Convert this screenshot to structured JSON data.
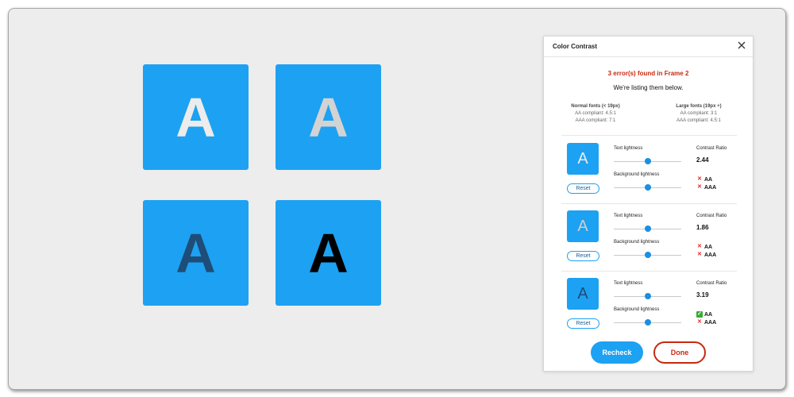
{
  "tiles": [
    {
      "letter": "A",
      "color": "#ececec"
    },
    {
      "letter": "A",
      "color": "#d3d3d3"
    },
    {
      "letter": "A",
      "color": "#1e4d78"
    },
    {
      "letter": "A",
      "color": "#000000"
    }
  ],
  "tile_background": "#1da1f2",
  "panel": {
    "title": "Color Contrast",
    "error_message": "3 error(s) found in Frame 2",
    "sub_message": "We're listing them below.",
    "normal_fonts": {
      "heading": "Normal fonts (< 19px)",
      "aa": "AA compliant: 4.5:1",
      "aaa": "AAA compliant: 7:1"
    },
    "large_fonts": {
      "heading": "Large fonts (19px +)",
      "aa": "AA compliant: 3:1",
      "aaa": "AAA compliant: 4.5:1"
    },
    "text_lightness_label": "Text lightness",
    "background_lightness_label": "Background lightness",
    "contrast_ratio_label": "Contrast Ratio",
    "reset_label": "Reset",
    "errors": [
      {
        "letter": "A",
        "letter_color": "#ececec",
        "ratio": "2.44",
        "text_lightness": 0.5,
        "background_lightness": 0.5,
        "aa": "AA",
        "aa_pass": false,
        "aaa": "AAA",
        "aaa_pass": false
      },
      {
        "letter": "A",
        "letter_color": "#cfcfcf",
        "ratio": "1.86",
        "text_lightness": 0.5,
        "background_lightness": 0.5,
        "aa": "AA",
        "aa_pass": false,
        "aaa": "AAA",
        "aaa_pass": false
      },
      {
        "letter": "A",
        "letter_color": "#1e4d78",
        "ratio": "3.19",
        "text_lightness": 0.5,
        "background_lightness": 0.5,
        "aa": "AA",
        "aa_pass": true,
        "aaa": "AAA",
        "aaa_pass": false
      }
    ],
    "recheck_label": "Recheck",
    "done_label": "Done"
  },
  "colors": {
    "accent": "#1da1f2",
    "error": "#c62a0e",
    "pass": "#3aaa35",
    "fail": "#e02424"
  },
  "icons": {
    "close": "close-icon",
    "pass": "check-icon",
    "fail": "cross-icon"
  }
}
